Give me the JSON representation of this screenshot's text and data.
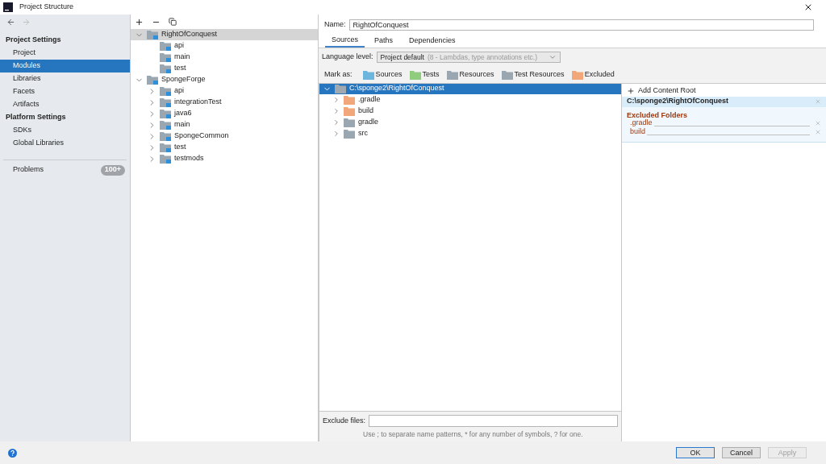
{
  "window": {
    "title": "Project Structure"
  },
  "sidebar": {
    "sections": [
      {
        "heading": "Project Settings",
        "items": [
          {
            "label": "Project",
            "selected": false
          },
          {
            "label": "Modules",
            "selected": true
          },
          {
            "label": "Libraries",
            "selected": false
          },
          {
            "label": "Facets",
            "selected": false
          },
          {
            "label": "Artifacts",
            "selected": false
          }
        ]
      },
      {
        "heading": "Platform Settings",
        "items": [
          {
            "label": "SDKs",
            "selected": false
          },
          {
            "label": "Global Libraries",
            "selected": false
          }
        ]
      }
    ],
    "problems": {
      "label": "Problems",
      "count": "100+"
    }
  },
  "module_tree": [
    {
      "label": "RightOfConquest",
      "expanded": true,
      "selected": true,
      "children": [
        {
          "label": "api",
          "expandable": false,
          "selected": false
        },
        {
          "label": "main",
          "expandable": false,
          "selected": false
        },
        {
          "label": "test",
          "expandable": false,
          "selected": false
        }
      ]
    },
    {
      "label": "SpongeForge",
      "expanded": true,
      "selected": false,
      "children": [
        {
          "label": "api",
          "expandable": true,
          "selected": false
        },
        {
          "label": "integrationTest",
          "expandable": true,
          "selected": false
        },
        {
          "label": "java6",
          "expandable": true,
          "selected": false
        },
        {
          "label": "main",
          "expandable": true,
          "selected": false
        },
        {
          "label": "SpongeCommon",
          "expandable": true,
          "selected": false
        },
        {
          "label": "test",
          "expandable": true,
          "selected": false
        },
        {
          "label": "testmods",
          "expandable": true,
          "selected": false
        }
      ]
    }
  ],
  "name_field": {
    "label": "Name:",
    "value": "RightOfConquest"
  },
  "tabs": [
    {
      "label": "Sources",
      "selected": true
    },
    {
      "label": "Paths",
      "selected": false
    },
    {
      "label": "Dependencies",
      "selected": false
    }
  ],
  "language_level": {
    "label": "Language level:",
    "value": "Project default",
    "hint": "(8 - Lambdas, type annotations etc.)"
  },
  "mark_as": {
    "label": "Mark as:",
    "options": [
      {
        "label": "Sources",
        "color": "#6eb5dd"
      },
      {
        "label": "Tests",
        "color": "#8fcc7d"
      },
      {
        "label": "Resources",
        "color": "#9aa7b0"
      },
      {
        "label": "Test Resources",
        "color": "#9aa7b0"
      },
      {
        "label": "Excluded",
        "color": "#f2a77a"
      }
    ]
  },
  "content_tree": {
    "label": "C:\\sponge2\\RightOfConquest",
    "expanded": true,
    "selected": true,
    "children": [
      {
        "label": ".gradle",
        "expanded": false,
        "color": "#f2a77a"
      },
      {
        "label": "build",
        "expanded": false,
        "color": "#f2a77a"
      },
      {
        "label": "gradle",
        "expanded": false,
        "color": "#9aa7b0"
      },
      {
        "label": "src",
        "expanded": false,
        "color": "#9aa7b0"
      }
    ]
  },
  "content_roots": {
    "add_label": "Add Content Root",
    "path": "C:\\sponge2\\RightOfConquest",
    "excluded_heading": "Excluded Folders",
    "excluded": [
      ".gradle",
      "build"
    ]
  },
  "exclude_files": {
    "label": "Exclude files:",
    "hint": "Use ; to separate name patterns, * for any number of symbols, ? for one."
  },
  "buttons": [
    {
      "label": "OK",
      "kind": "default",
      "disabled": false
    },
    {
      "label": "Cancel",
      "kind": "normal",
      "disabled": false
    },
    {
      "label": "Apply",
      "kind": "normal",
      "disabled": true
    }
  ]
}
